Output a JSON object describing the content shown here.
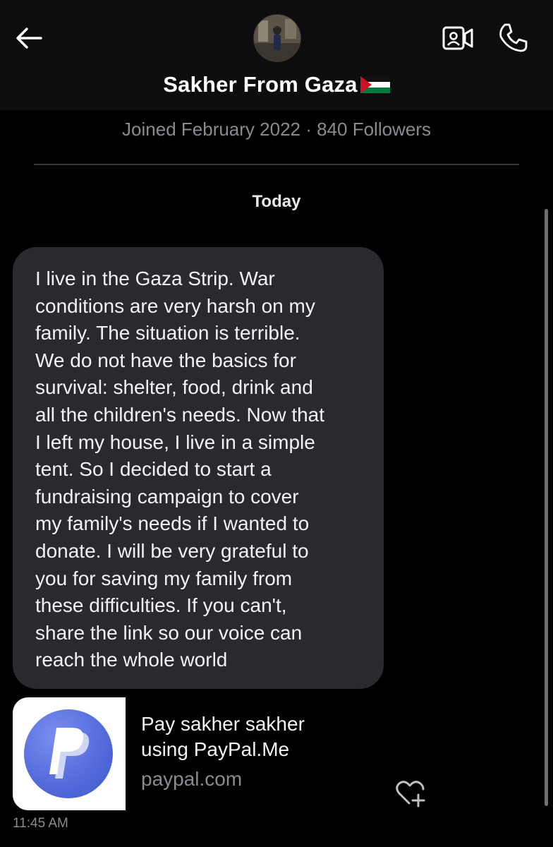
{
  "header": {
    "contact_name": "Sakher From Gaza",
    "flag_icon": "palestine-flag-icon",
    "back_icon": "arrow-left-icon",
    "video_icon": "video-call-icon",
    "phone_icon": "phone-icon"
  },
  "profile": {
    "subline": "Joined February 2022 · 840 Followers"
  },
  "conversation": {
    "date_label": "Today",
    "messages": [
      {
        "text": "I live in the Gaza Strip. War\nconditions are very harsh on my\nfamily. The situation is terrible.\nWe do not have the basics for\nsurvival: shelter, food, drink and\nall the children's needs. Now that\nI left my house, I live in a simple\ntent. So I decided to start a\nfundraising campaign to cover\nmy family's needs if I wanted to\ndonate. I will be very grateful to\nyou for saving my family from\nthese difficulties. If you can't,\nshare the link so our voice can\nreach the whole world"
      }
    ],
    "link_preview": {
      "title": "Pay sakher sakher\nusing PayPal.Me",
      "domain": "paypal.com",
      "logo_icon": "paypal-logo-icon"
    },
    "react_icon": "heart-plus-icon",
    "timestamp": "11:45 AM"
  },
  "colors": {
    "background": "#000000",
    "header_bg": "#0d0d0f",
    "bubble_bg": "#2a2a2e",
    "muted_text": "#8a8a90",
    "flag_red": "#ce1126",
    "flag_green": "#007a3d"
  }
}
